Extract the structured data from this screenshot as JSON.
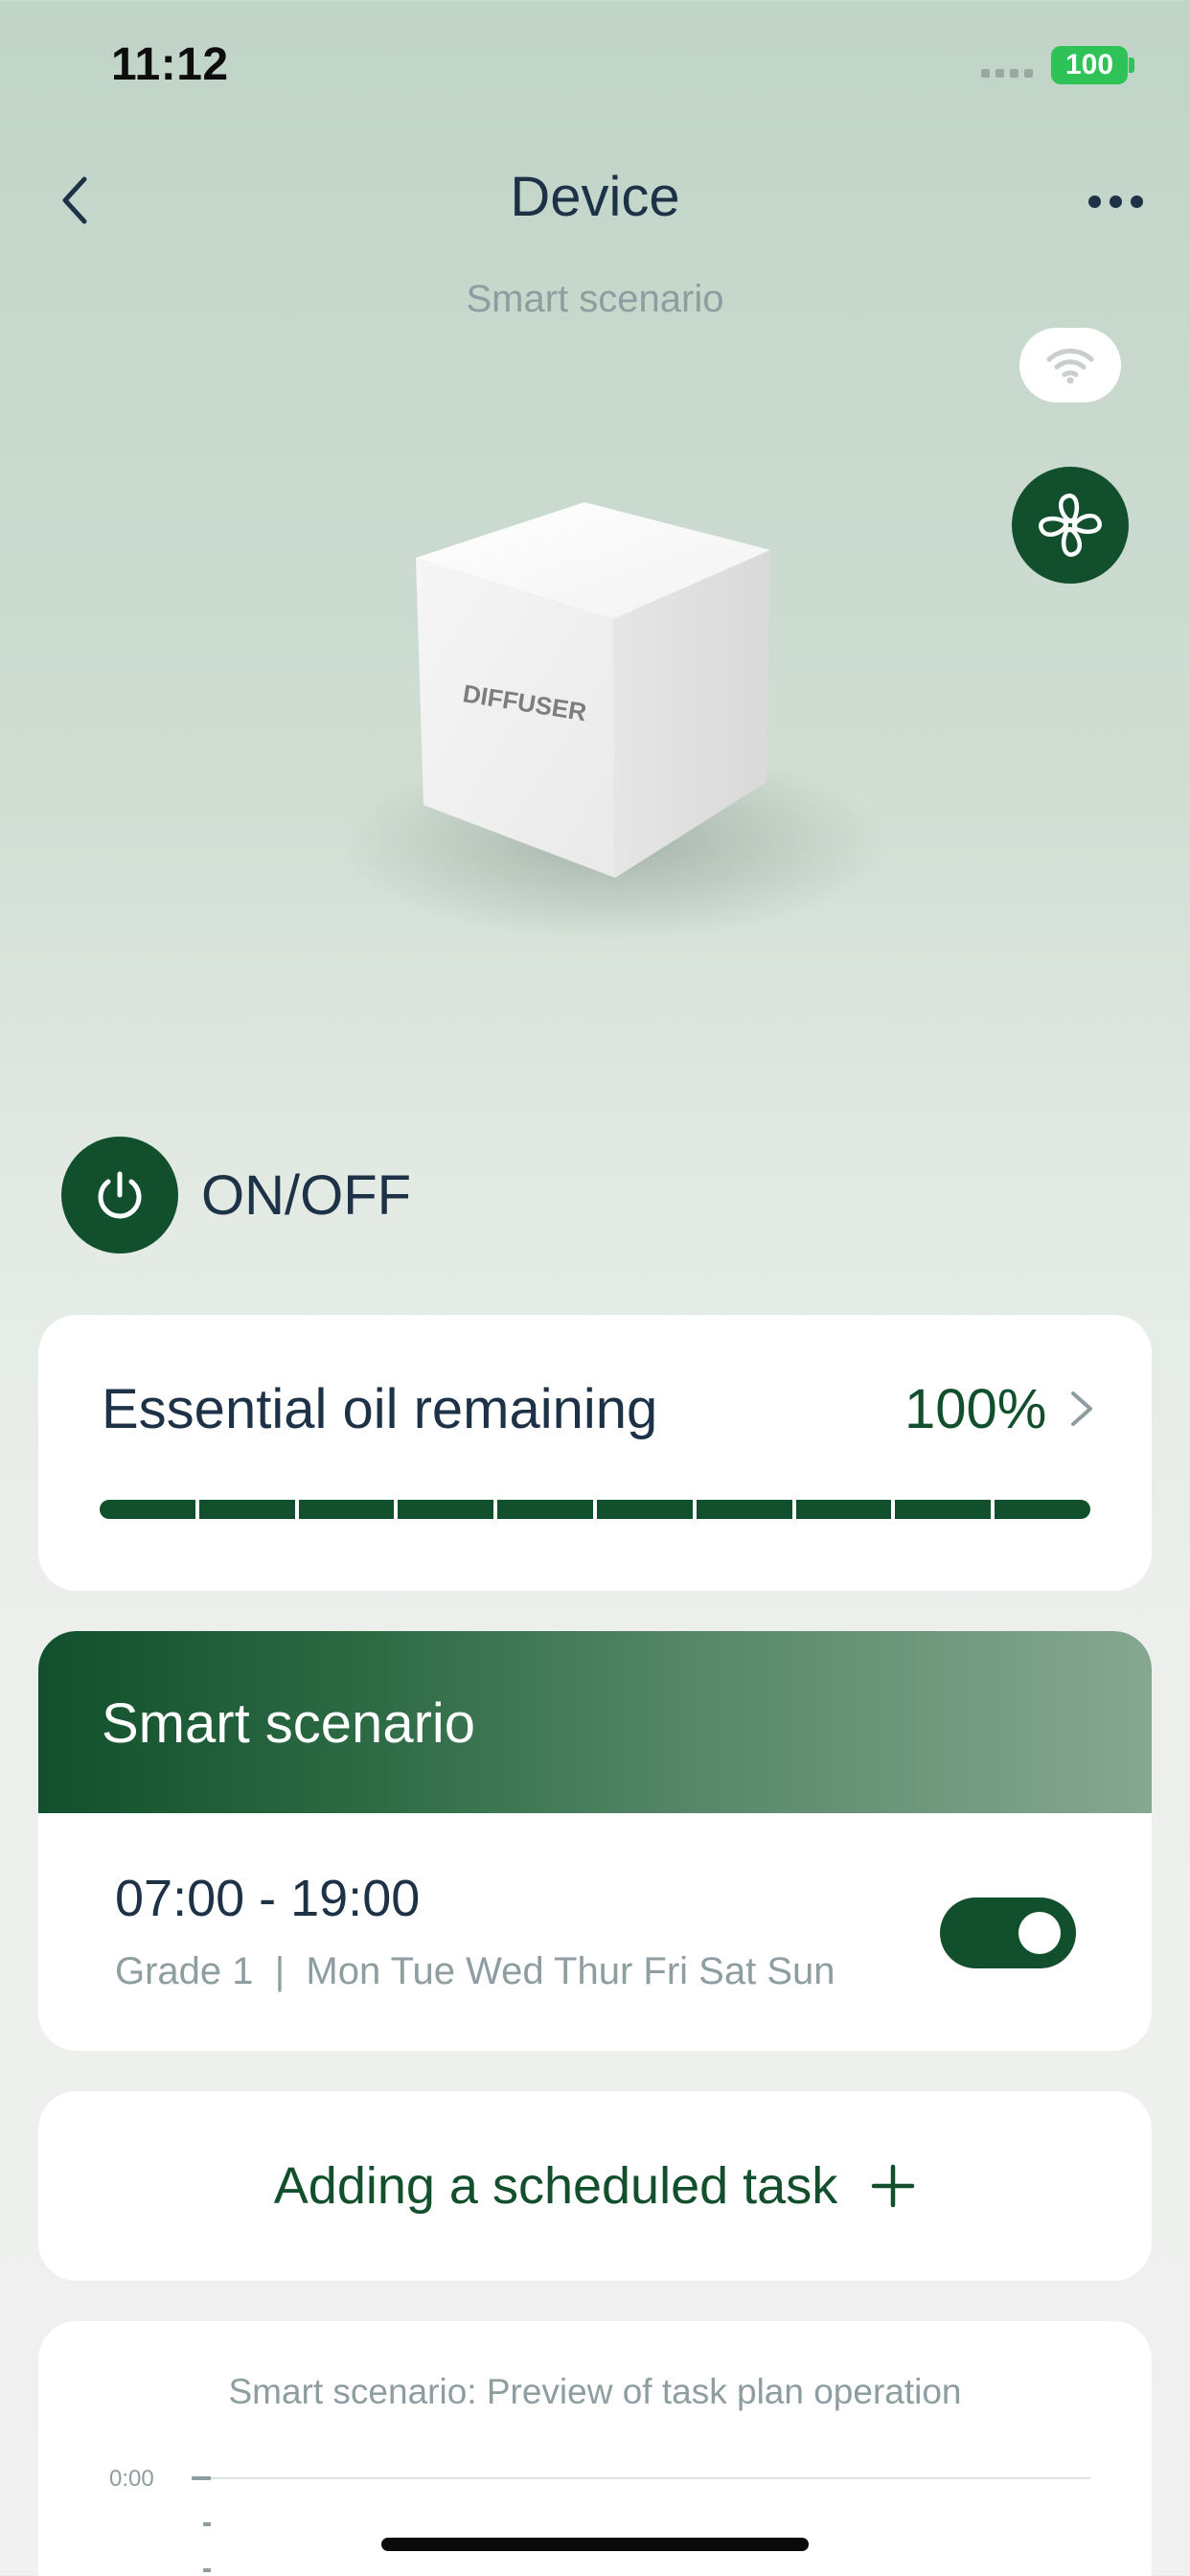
{
  "status_bar": {
    "time": "11:12",
    "battery": "100"
  },
  "nav": {
    "title": "Device",
    "back_icon": "chevron-left-icon",
    "more_icon": "ellipsis-icon"
  },
  "subtitle": "Smart scenario",
  "device": {
    "label": "DIFFUSER"
  },
  "power": {
    "label": "ON/OFF"
  },
  "oil": {
    "title": "Essential oil remaining",
    "value": "100%",
    "level_fraction": 1.0,
    "segments": 10
  },
  "scenario": {
    "title": "Smart scenario",
    "task": {
      "time": "07:00 - 19:00",
      "detail": "Grade 1  |  Mon Tue Wed Thur Fri Sat Sun",
      "enabled": true
    }
  },
  "add_task": {
    "label": "Adding a scheduled task"
  },
  "preview": {
    "title": "Smart scenario: Preview of task plan operation",
    "y_start": "0:00"
  },
  "colors": {
    "accent": "#12502d",
    "text": "#1d3247",
    "muted": "#8e9da0",
    "battery": "#2fc257"
  }
}
